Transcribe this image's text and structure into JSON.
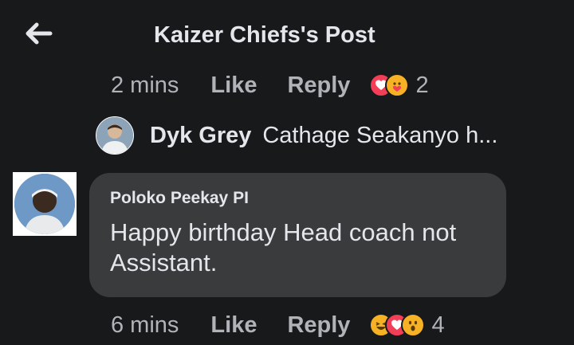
{
  "header": {
    "title": "Kaizer Chiefs's Post"
  },
  "comment1_meta": {
    "time": "2 mins",
    "like_label": "Like",
    "reply_label": "Reply",
    "reactions": [
      "love",
      "care"
    ],
    "reaction_count": "2"
  },
  "reply_preview": {
    "name": "Dyk Grey",
    "text": "Cathage Seakanyo h..."
  },
  "comment2": {
    "author": "Poloko Peekay PI",
    "text": "Happy birthday Head coach not Assistant."
  },
  "comment2_meta": {
    "time": "6 mins",
    "like_label": "Like",
    "reply_label": "Reply",
    "reactions": [
      "haha",
      "love",
      "wow"
    ],
    "reaction_count": "4"
  },
  "colors": {
    "background": "#18191a",
    "bubble": "#3a3b3c",
    "text": "#e4e6eb",
    "secondary_text": "#b0b3b8",
    "love": "#f33e58",
    "haha": "#f7b125"
  }
}
